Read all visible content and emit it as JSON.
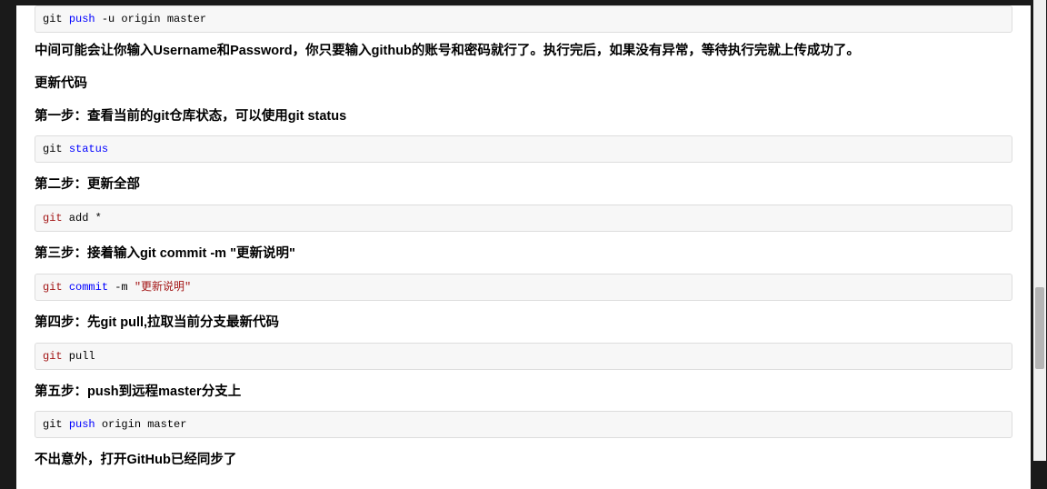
{
  "blocks": [
    {
      "type": "code",
      "name": "code-git-push-u",
      "tokens": [
        {
          "text": "git ",
          "cls": "plain"
        },
        {
          "text": "push",
          "cls": "kw-blue"
        },
        {
          "text": " -u origin master",
          "cls": "plain"
        }
      ]
    },
    {
      "type": "para",
      "name": "para-username-password",
      "text": "中间可能会让你输入Username和Password，你只要输入github的账号和密码就行了。执行完后，如果没有异常，等待执行完就上传成功了。"
    },
    {
      "type": "heading",
      "name": "heading-update-code",
      "text": "更新代码"
    },
    {
      "type": "heading",
      "name": "heading-step1",
      "text": "第一步：查看当前的git仓库状态，可以使用git status"
    },
    {
      "type": "code",
      "name": "code-git-status",
      "tokens": [
        {
          "text": "git ",
          "cls": "plain"
        },
        {
          "text": "status",
          "cls": "kw-blue"
        }
      ]
    },
    {
      "type": "heading",
      "name": "heading-step2",
      "text": "第二步：更新全部"
    },
    {
      "type": "code",
      "name": "code-git-add-all",
      "tokens": [
        {
          "text": "git",
          "cls": "kw-red"
        },
        {
          "text": " add *",
          "cls": "plain"
        }
      ]
    },
    {
      "type": "heading",
      "name": "heading-step3",
      "text": "第三步：接着输入git commit -m \"更新说明\""
    },
    {
      "type": "code",
      "name": "code-git-commit",
      "tokens": [
        {
          "text": "git",
          "cls": "kw-red"
        },
        {
          "text": " ",
          "cls": "plain"
        },
        {
          "text": "commit",
          "cls": "kw-blue"
        },
        {
          "text": " -m ",
          "cls": "plain"
        },
        {
          "text": "\"更新说明\"",
          "cls": "kw-red"
        }
      ]
    },
    {
      "type": "heading",
      "name": "heading-step4",
      "text": "第四步：先git pull,拉取当前分支最新代码"
    },
    {
      "type": "code",
      "name": "code-git-pull",
      "tokens": [
        {
          "text": "git",
          "cls": "kw-red"
        },
        {
          "text": " pull",
          "cls": "plain"
        }
      ]
    },
    {
      "type": "heading",
      "name": "heading-step5",
      "text": "第五步：push到远程master分支上"
    },
    {
      "type": "code",
      "name": "code-git-push-origin",
      "tokens": [
        {
          "text": "git ",
          "cls": "plain"
        },
        {
          "text": "push",
          "cls": "kw-blue"
        },
        {
          "text": " origin master",
          "cls": "plain"
        }
      ]
    },
    {
      "type": "heading",
      "name": "heading-conclusion",
      "text": "不出意外，打开GitHub已经同步了"
    }
  ]
}
